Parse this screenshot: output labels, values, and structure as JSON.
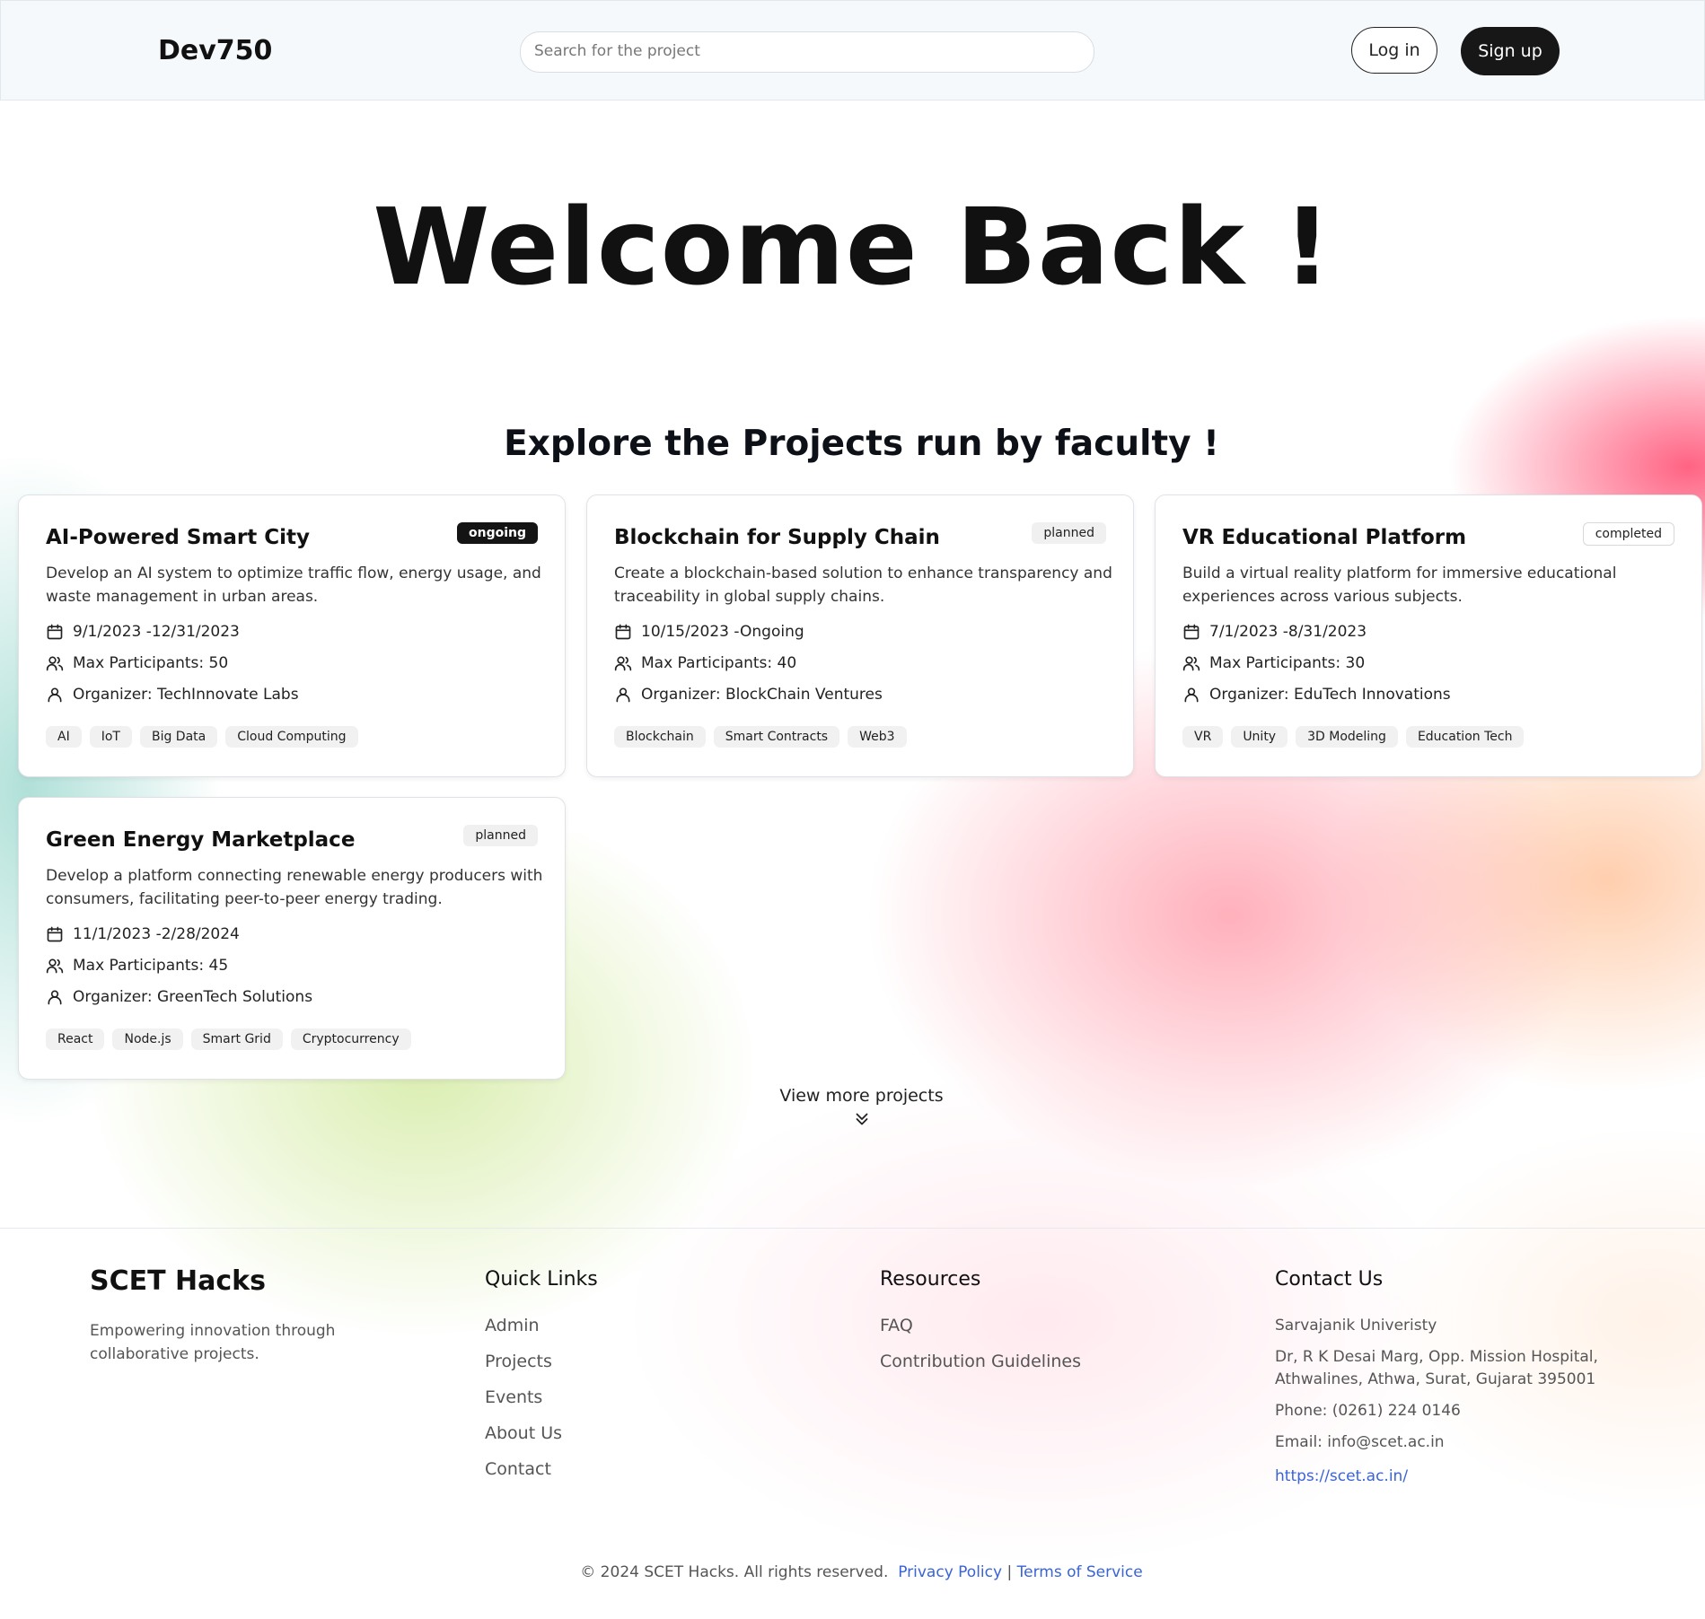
{
  "header": {
    "logo": "Dev750",
    "search_placeholder": "Search for the project",
    "login_label": "Log in",
    "signup_label": "Sign up"
  },
  "hero": {
    "title": "Welcome Back !"
  },
  "projects_section": {
    "title": "Explore the Projects run by faculty !",
    "view_more": "View more projects",
    "projects": [
      {
        "title": "AI-Powered Smart City",
        "status": "ongoing",
        "description": "Develop an AI system to optimize traffic flow, energy usage, and waste management in urban areas.",
        "dates": "9/1/2023 -12/31/2023",
        "max_participants": "Max Participants: 50",
        "organizer": "Organizer: TechInnovate Labs",
        "tags": [
          "AI",
          "IoT",
          "Big Data",
          "Cloud Computing"
        ]
      },
      {
        "title": "Blockchain for Supply Chain",
        "status": "planned",
        "description": "Create a blockchain-based solution to enhance transparency and traceability in global supply chains.",
        "dates": "10/15/2023 -Ongoing",
        "max_participants": "Max Participants: 40",
        "organizer": "Organizer: BlockChain Ventures",
        "tags": [
          "Blockchain",
          "Smart Contracts",
          "Web3"
        ]
      },
      {
        "title": "VR Educational Platform",
        "status": "completed",
        "description": "Build a virtual reality platform for immersive educational experiences across various subjects.",
        "dates": "7/1/2023 -8/31/2023",
        "max_participants": "Max Participants: 30",
        "organizer": "Organizer: EduTech Innovations",
        "tags": [
          "VR",
          "Unity",
          "3D Modeling",
          "Education Tech"
        ]
      },
      {
        "title": "Green Energy Marketplace",
        "status": "planned",
        "description": "Develop a platform connecting renewable energy producers with consumers, facilitating peer-to-peer energy trading.",
        "dates": "11/1/2023 -2/28/2024",
        "max_participants": "Max Participants: 45",
        "organizer": "Organizer: GreenTech Solutions",
        "tags": [
          "React",
          "Node.js",
          "Smart Grid",
          "Cryptocurrency"
        ]
      }
    ]
  },
  "footer": {
    "brand": "SCET Hacks",
    "tagline": "Empowering innovation through collaborative projects.",
    "quick_links_title": "Quick Links",
    "quick_links": [
      "Admin",
      "Projects",
      "Events",
      "About Us",
      "Contact"
    ],
    "resources_title": "Resources",
    "resources": [
      "FAQ",
      "Contribution Guidelines"
    ],
    "contact_title": "Contact Us",
    "contact_org": "Sarvajanik Univeristy",
    "contact_address": "Dr, R K Desai Marg, Opp. Mission Hospital, Athwalines, Athwa, Surat, Gujarat 395001",
    "contact_phone": "Phone: (0261) 224 0146",
    "contact_email": "Email: info@scet.ac.in",
    "contact_url": "https://scet.ac.in/",
    "copyright": "© 2024 SCET Hacks. All rights reserved.",
    "privacy": "Privacy Policy",
    "separator": "|",
    "terms": "Terms of Service"
  },
  "colors": {
    "accent_dark": "#171717",
    "link_blue": "#3a63d6"
  },
  "icons": {
    "date": "calendar-icon",
    "participants": "users-icon",
    "organizer": "user-icon",
    "view_more": "double-chevron-down-icon"
  }
}
